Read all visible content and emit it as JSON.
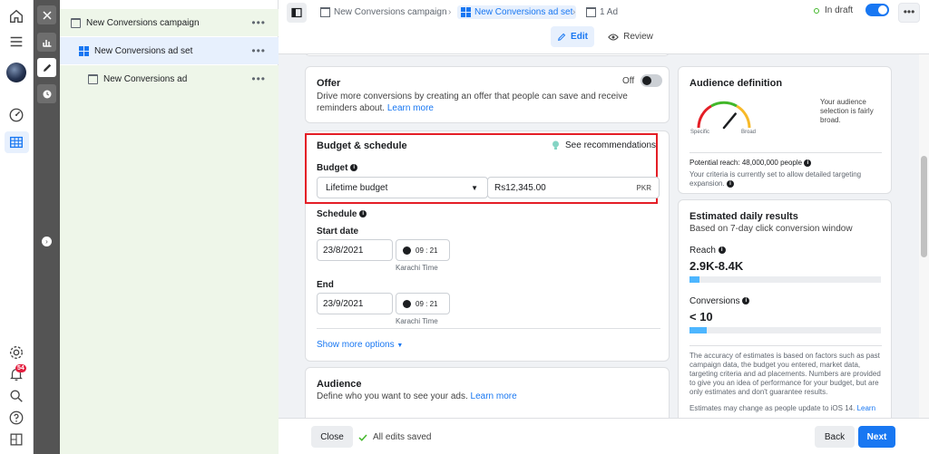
{
  "tree": {
    "campaign": "New Conversions campaign",
    "adset": "New Conversions ad set",
    "ad": "New Conversions ad",
    "more": "•••"
  },
  "header": {
    "breadcrumbs": [
      "New Conversions campaign",
      "New Conversions ad set",
      "1 Ad"
    ],
    "status": "In draft",
    "more": "•••",
    "tabs": {
      "edit": "Edit",
      "review": "Review"
    }
  },
  "offer": {
    "title": "Offer",
    "toggle_label": "Off",
    "description": "Drive more conversions by creating an offer that people can save and receive reminders about.",
    "learn_more": "Learn more"
  },
  "budget": {
    "title": "Budget & schedule",
    "recommendations": "See recommendations",
    "budget_label": "Budget",
    "type_value": "Lifetime budget",
    "amount": "Rs12,345.00",
    "currency": "PKR",
    "schedule_label": "Schedule",
    "start_label": "Start date",
    "start_date": "23/8/2021",
    "start_time": "09 : 21",
    "end_label": "End",
    "end_date": "23/9/2021",
    "end_time": "09 : 21",
    "timezone": "Karachi Time",
    "show_more": "Show more options"
  },
  "audience": {
    "title": "Audience",
    "description": "Define who you want to see your ads.",
    "learn_more": "Learn more"
  },
  "audience_definition": {
    "title": "Audience definition",
    "summary": "Your audience selection is fairly broad.",
    "specific": "Specific",
    "broad": "Broad",
    "reach": "Potential reach: 48,000,000 people",
    "criteria": "Your criteria is currently set to allow detailed targeting expansion.",
    "gauge_level": 0.72
  },
  "estimated": {
    "title": "Estimated daily results",
    "subtitle": "Based on 7-day click conversion window",
    "reach_label": "Reach",
    "reach_value": "2.9K-8.4K",
    "reach_fill": 0.05,
    "conversions_label": "Conversions",
    "conversions_value": "< 10",
    "conversions_fill": 0.09,
    "disclaimer": "The accuracy of estimates is based on factors such as past campaign data, the budget you entered, market data, targeting criteria and ad placements. Numbers are provided to give you an idea of performance for your budget, but are only estimates and don't guarantee results.",
    "ios_note": "Estimates may change as people update to iOS 14.",
    "ios_learn": "Learn"
  },
  "footer": {
    "close": "Close",
    "saved": "All edits saved",
    "back": "Back",
    "next": "Next"
  },
  "rail": {
    "notification_count": "54"
  },
  "colors": {
    "accent": "#1877f2",
    "highlight_border": "#e41e26",
    "bar": "#4db6ff"
  }
}
